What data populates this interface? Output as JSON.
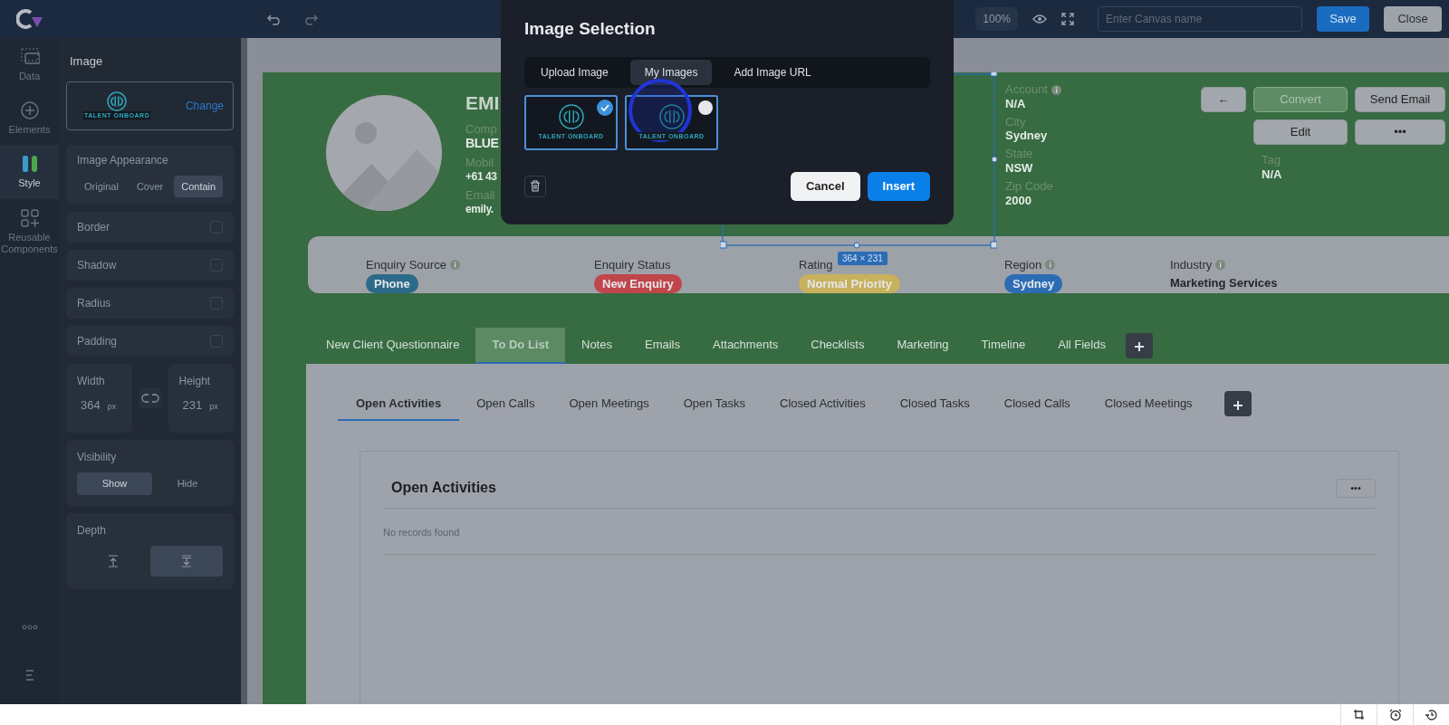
{
  "toolbar": {
    "zoom": "100%",
    "canvas_name": {
      "placeholder": "Enter Canvas name"
    },
    "buttons": [
      {
        "label": "Save",
        "kind": "primary"
      },
      {
        "label": "Close",
        "kind": "secondary"
      }
    ]
  },
  "rail": [
    {
      "label": "Data",
      "kind": "data",
      "selected": false
    },
    {
      "label": "Elements",
      "kind": "elements",
      "selected": false
    },
    {
      "label": "Style",
      "kind": "style",
      "selected": true
    },
    {
      "label": "Reusable Components",
      "kind": "components",
      "selected": false
    }
  ],
  "panel": {
    "title": "Image",
    "preview_caption": "TALENT ONBOARD",
    "change": "Change",
    "appearance": {
      "label": "Image Appearance",
      "options": [
        {
          "label": "Original",
          "selected": false
        },
        {
          "label": "Cover",
          "selected": false
        },
        {
          "label": "Contain",
          "selected": true
        }
      ]
    },
    "toggles": [
      {
        "label": "Border",
        "checked": false
      },
      {
        "label": "Shadow",
        "checked": false
      },
      {
        "label": "Radius",
        "checked": false
      },
      {
        "label": "Padding",
        "checked": false
      }
    ],
    "width": {
      "label": "Width",
      "value": "364",
      "unit": "px"
    },
    "height": {
      "label": "Height",
      "value": "231",
      "unit": "px"
    },
    "visibility": {
      "label": "Visibility",
      "options": [
        {
          "label": "Show",
          "selected": true
        },
        {
          "label": "Hide",
          "selected": false
        }
      ]
    },
    "depth": {
      "label": "Depth",
      "options": [
        {
          "kind": "front",
          "selected": false
        },
        {
          "kind": "back",
          "selected": true
        }
      ]
    }
  },
  "record": {
    "name": "EMI",
    "fields_left": [
      {
        "label": "Comp",
        "value": "BLUE"
      },
      {
        "label": "Mobil",
        "value": "+61 43"
      },
      {
        "label": "Email",
        "value": "emily."
      }
    ],
    "fields_right": [
      {
        "label": "Account",
        "value": "N/A",
        "info": true
      },
      {
        "label": "City",
        "value": "Sydney",
        "info": false
      },
      {
        "label": "State",
        "value": "NSW",
        "info": false
      },
      {
        "label": "Zip Code",
        "value": "2000",
        "info": false
      }
    ],
    "tag": {
      "label": "Tag",
      "value": "N/A"
    },
    "actions": [
      {
        "label": "←",
        "kind": "default"
      },
      {
        "label": "Convert",
        "kind": "success"
      },
      {
        "label": "Send Email",
        "kind": "default"
      },
      {
        "label": "Edit",
        "kind": "default"
      },
      {
        "label": "•••",
        "kind": "default"
      }
    ]
  },
  "selection": {
    "size": "364 × 231"
  },
  "summary": [
    {
      "label": "Enquiry Source",
      "info": true,
      "value": "Phone",
      "color": "#2c6a89"
    },
    {
      "label": "Enquiry Status",
      "info": false,
      "value": "New Enquiry",
      "color": "#c0464c"
    },
    {
      "label": "Rating",
      "info": false,
      "value": "Normal Priority",
      "color": "#c8b15c"
    },
    {
      "label": "Region",
      "info": true,
      "value": "Sydney",
      "color": "#2b6cb5"
    },
    {
      "label": "Industry",
      "info": true,
      "value": "Marketing Services"
    }
  ],
  "tabs": [
    {
      "label": "New Client Questionnaire",
      "selected": false
    },
    {
      "label": "To Do List",
      "selected": true
    },
    {
      "label": "Notes",
      "selected": false
    },
    {
      "label": "Emails",
      "selected": false
    },
    {
      "label": "Attachments",
      "selected": false
    },
    {
      "label": "Checklists",
      "selected": false
    },
    {
      "label": "Marketing",
      "selected": false
    },
    {
      "label": "Timeline",
      "selected": false
    },
    {
      "label": "All Fields",
      "selected": false
    }
  ],
  "subtabs": [
    {
      "label": "Open Activities",
      "selected": true
    },
    {
      "label": "Open Calls",
      "selected": false
    },
    {
      "label": "Open Meetings",
      "selected": false
    },
    {
      "label": "Open Tasks",
      "selected": false
    },
    {
      "label": "Closed Activities",
      "selected": false
    },
    {
      "label": "Closed Tasks",
      "selected": false
    },
    {
      "label": "Closed Calls",
      "selected": false
    },
    {
      "label": "Closed Meetings",
      "selected": false
    }
  ],
  "section": {
    "title": "Open Activities",
    "more": "•••",
    "empty": "No records found"
  },
  "dialog": {
    "title": "Image Selection",
    "tabs": [
      {
        "label": "Upload Image",
        "selected": false
      },
      {
        "label": "My Images",
        "selected": true
      },
      {
        "label": "Add Image URL",
        "selected": false
      }
    ],
    "images": [
      {
        "caption": "TALENT ONBOARD",
        "selected": true
      },
      {
        "caption": "TALENT ONBOARD",
        "selected": false
      }
    ],
    "buttons": [
      {
        "label": "Cancel",
        "kind": "secondary"
      },
      {
        "label": "Insert",
        "kind": "primary"
      }
    ]
  }
}
